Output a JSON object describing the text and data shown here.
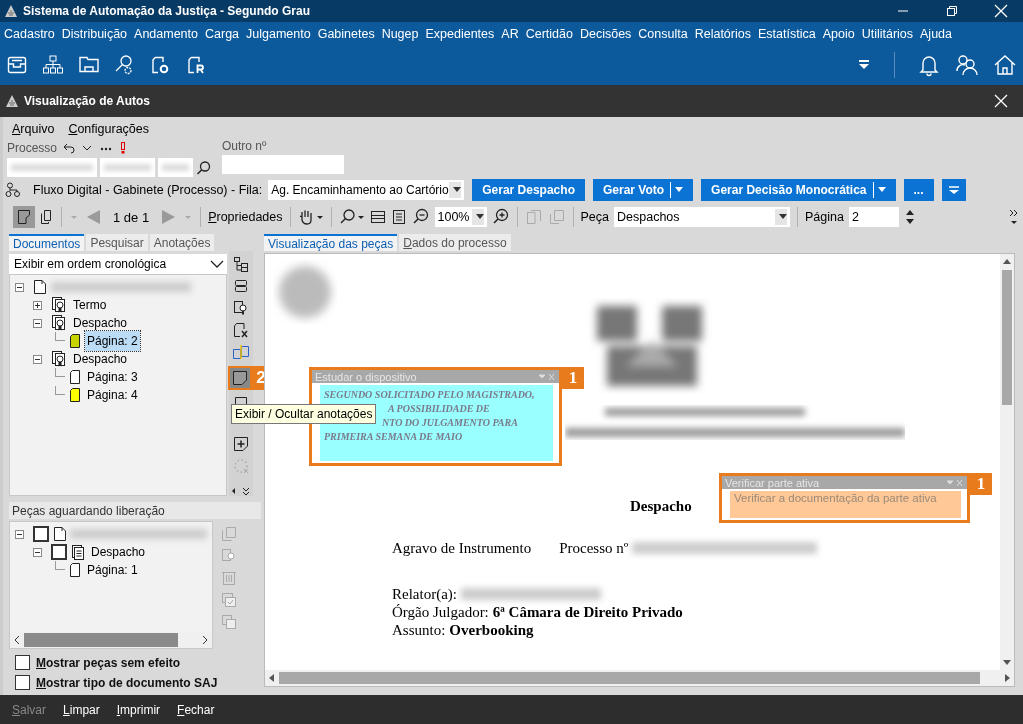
{
  "window": {
    "title": "Sistema de Automação da Justiça - Segundo Grau"
  },
  "menu": [
    "Cadastro",
    "Distribuição",
    "Andamento",
    "Carga",
    "Julgamento",
    "Gabinetes",
    "Nugep",
    "Expedientes",
    "AR",
    "Certidão",
    "Decisões",
    "Consulta",
    "Relatórios",
    "Estatística",
    "Apoio",
    "Utilitários",
    "Ajuda"
  ],
  "child_window": {
    "title": "Visualização de Autos"
  },
  "child_menu": [
    "Arquivo",
    "Configurações"
  ],
  "process": {
    "label": "Processo",
    "other_label": "Outro nº"
  },
  "flow": {
    "label": "Fluxo Digital - Gabinete (Processo) - Fila:",
    "queue": "Ag. Encaminhamento ao Cartório"
  },
  "actions": [
    {
      "label": "Gerar Despacho",
      "dropdown": false
    },
    {
      "label": "Gerar Voto",
      "dropdown": true
    },
    {
      "label": "Gerar Decisão Monocrática",
      "dropdown": true
    },
    {
      "label": "...",
      "dropdown": false
    }
  ],
  "toolbar": {
    "pager": "1 de 1",
    "properties": "Propriedades",
    "zoom": "100%",
    "piece_label": "Peça",
    "piece": "Despachos",
    "page_label": "Página",
    "page": "2"
  },
  "left_tabs": [
    {
      "label": "Documentos",
      "selected": true
    },
    {
      "label": "Pesquisar",
      "selected": false
    },
    {
      "label": "Anotações",
      "selected": false
    }
  ],
  "order_select": "Exibir em ordem cronológica",
  "tree": [
    {
      "kind": "root",
      "expanded": true,
      "children": [
        {
          "kind": "group",
          "label": "Termo",
          "expanded": false
        },
        {
          "kind": "group",
          "label": "Despacho",
          "expanded": true,
          "children": [
            {
              "kind": "page",
              "label": "Página: 2",
              "selected": true,
              "color": "#c8d400"
            }
          ]
        },
        {
          "kind": "group",
          "label": "Despacho",
          "expanded": true,
          "children": [
            {
              "kind": "page",
              "label": "Página: 3",
              "selected": false,
              "color": "#ffffff"
            },
            {
              "kind": "page",
              "label": "Página: 4",
              "selected": false,
              "color": "#ffff00"
            }
          ]
        }
      ]
    }
  ],
  "pending": {
    "title": "Peças aguardando liberação",
    "tree": [
      {
        "kind": "root",
        "expanded": true,
        "checked": false,
        "children": [
          {
            "kind": "doc",
            "label": "Despacho",
            "expanded": true,
            "checked": false,
            "children": [
              {
                "kind": "page",
                "label": "Página: 1",
                "selected": false,
                "color": "#ffffff"
              }
            ]
          }
        ]
      }
    ]
  },
  "options": [
    {
      "label": "Mostrar peças sem efeito",
      "checked": false
    },
    {
      "label": "Mostrar tipo de documento SAJ",
      "checked": false
    }
  ],
  "doc_tabs": [
    {
      "label": "Visualização das peças",
      "selected": true
    },
    {
      "label": "Dados do processo",
      "selected": false
    }
  ],
  "notes": [
    {
      "title": "Estudar o dispositivo",
      "lines": [
        "SEGUNDO SOLICITADO PELO MAGISTRADO,",
        "A POSSIBILIDADE DE",
        "NTO DO JULGAMENTO PARA",
        "PRIMEIRA SEMANA DE MAIO"
      ],
      "color": "#99ffff",
      "callout": "1"
    },
    {
      "title": "Verificar parte ativa",
      "lines": [
        "Verificar a documentação da parte ativa"
      ],
      "color": "#ffc896",
      "callout": "1"
    }
  ],
  "annotation_callout": "2",
  "tooltip": "Exibir / Ocultar anotações",
  "document": {
    "heading": "Despacho",
    "case_type": "Agravo de Instrumento",
    "process_label": "Processo nº",
    "relator_label": "Relator(a):",
    "organ_label": "Órgão Julgador:",
    "organ": "6ª Câmara de Direito Privado",
    "subject_label": "Assunto:",
    "subject": "Overbooking"
  },
  "footer": [
    {
      "label": "Salvar",
      "disabled": true
    },
    {
      "label": "Limpar",
      "disabled": false
    },
    {
      "label": "Imprimir",
      "disabled": false
    },
    {
      "label": "Fechar",
      "disabled": false
    }
  ]
}
